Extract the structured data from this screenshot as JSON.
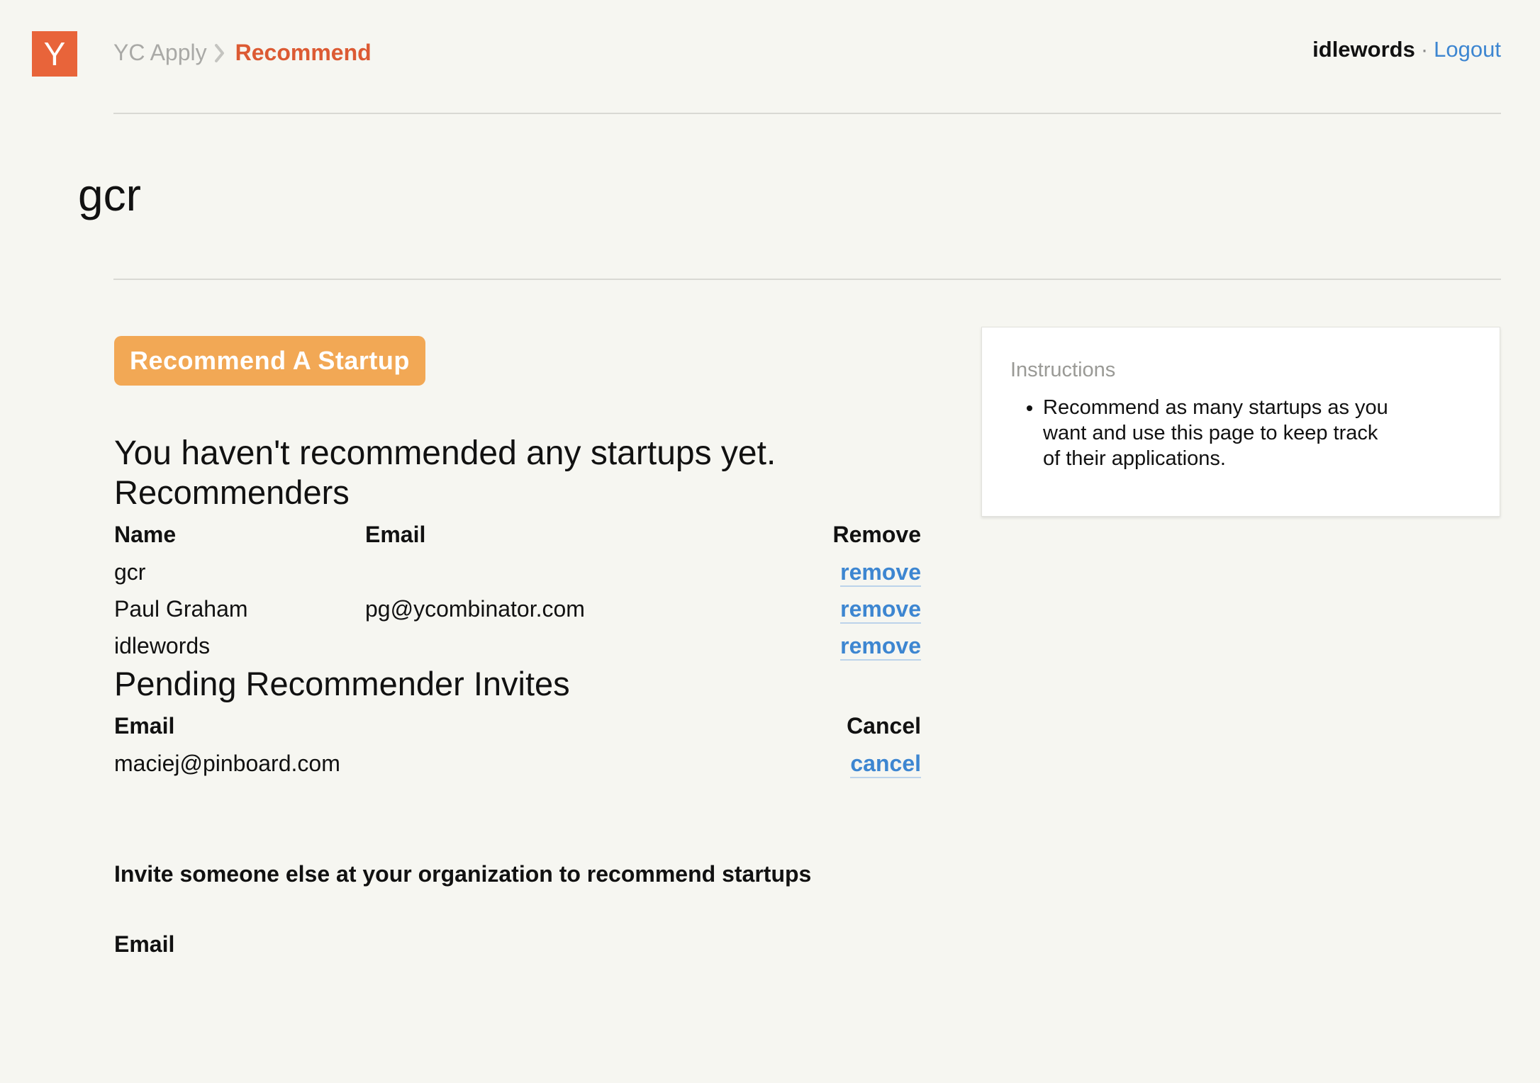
{
  "header": {
    "logo_letter": "Y",
    "breadcrumb_root": "YC Apply",
    "breadcrumb_current": "Recommend",
    "username": "idlewords",
    "separator": "·",
    "logout_label": "Logout"
  },
  "page": {
    "title": "gcr"
  },
  "main": {
    "recommend_button": "Recommend A Startup",
    "empty_message": "You haven't recommended any startups yet."
  },
  "recommenders": {
    "heading": "Recommenders",
    "columns": {
      "name": "Name",
      "email": "Email",
      "remove": "Remove"
    },
    "rows": [
      {
        "name": "gcr",
        "email": "",
        "action": "remove"
      },
      {
        "name": "Paul Graham",
        "email": "pg@ycombinator.com",
        "action": "remove"
      },
      {
        "name": "idlewords",
        "email": "",
        "action": "remove"
      }
    ]
  },
  "pending": {
    "heading": "Pending Recommender Invites",
    "columns": {
      "email": "Email",
      "cancel": "Cancel"
    },
    "rows": [
      {
        "email": "maciej@pinboard.com",
        "action": "cancel"
      }
    ]
  },
  "invite": {
    "title": "Invite someone else at your organization to recommend startups",
    "email_label": "Email"
  },
  "instructions": {
    "title": "Instructions",
    "items": [
      "Recommend as many startups as you want and use this page to keep track of their applications."
    ]
  },
  "colors": {
    "brand_orange": "#e8643a",
    "breadcrumb_active": "#dc5a33",
    "button_orange": "#f2a855",
    "link_blue": "#3d86d1",
    "background": "#f6f6f1"
  }
}
